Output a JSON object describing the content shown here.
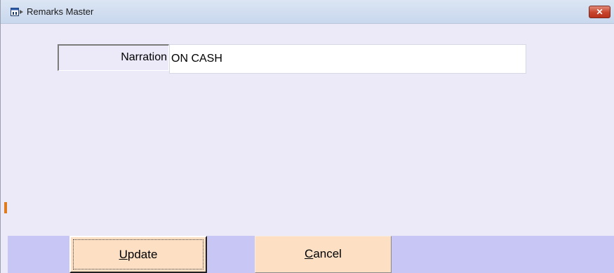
{
  "window": {
    "title": "Remarks Master",
    "close_glyph": "✕",
    "app_icon": "app-window-icon"
  },
  "form": {
    "narration_label": "Narration",
    "narration_value": "ON CASH"
  },
  "buttons": {
    "update_hotkey": "U",
    "update_rest": "pdate",
    "cancel_hotkey": "C",
    "cancel_rest": "ancel"
  },
  "colors": {
    "form_background": "#eceaf9",
    "button_bar": "#c7c6f4",
    "button_face": "#fde0c4",
    "close_button": "#c8442c"
  }
}
